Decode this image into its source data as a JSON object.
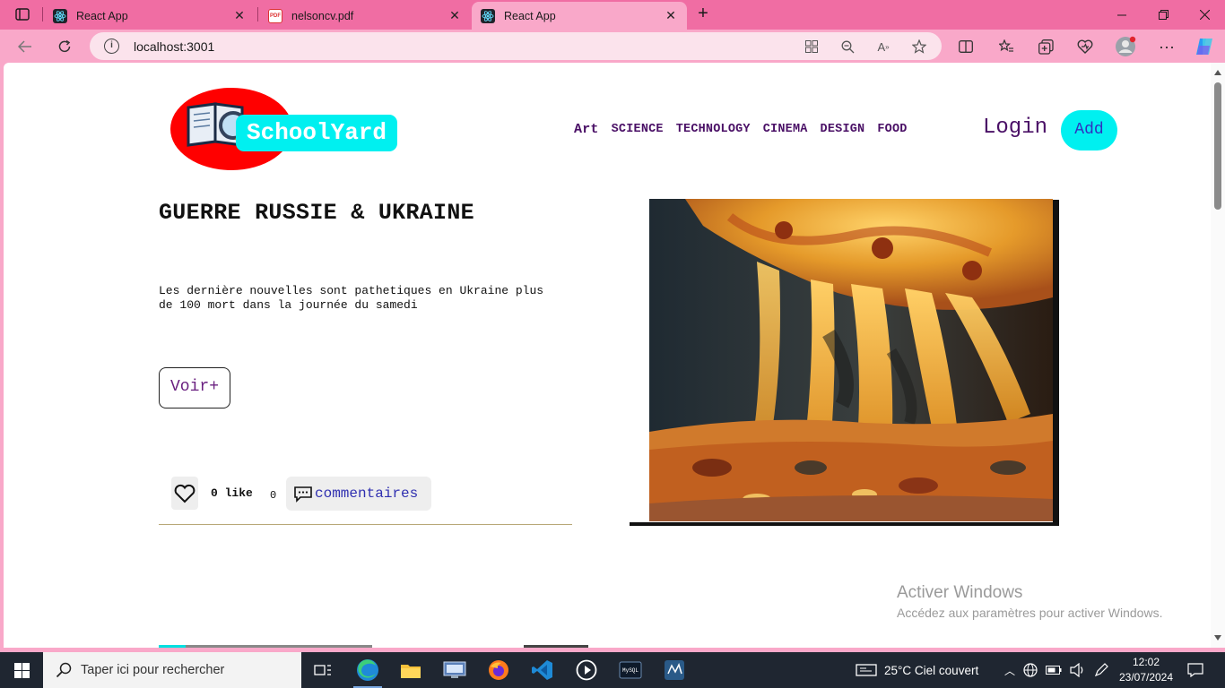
{
  "browser": {
    "tabs": [
      {
        "title": "React App",
        "type": "react"
      },
      {
        "title": "nelsoncv.pdf",
        "type": "pdf"
      },
      {
        "title": "React App",
        "type": "react"
      }
    ],
    "url": "localhost:3001"
  },
  "site": {
    "logo_text": "SchoolYard",
    "nav": [
      "Art",
      "SCIENCE",
      "TECHNOLOGY",
      "CINEMA",
      "DESIGN",
      "FOOD"
    ],
    "login_label": "Login",
    "add_label": "Add"
  },
  "post": {
    "title": "GUERRE RUSSIE & UKRAINE",
    "description": "Les dernière nouvelles sont pathetiques en Ukraine plus de 100 mort dans la journée du samedi",
    "voir_label": "Voir+",
    "like_label": "0 like",
    "comment_count": "0",
    "comment_label": "commentaires",
    "image_subject": "cheesy pizza slice"
  },
  "watermark": {
    "line1": "Activer Windows",
    "line2": "Accédez aux paramètres pour activer Windows."
  },
  "taskbar": {
    "search_placeholder": "Taper ici pour rechercher",
    "weather": "25°C  Ciel couvert",
    "time": "12:02",
    "date": "23/07/2024"
  },
  "colors": {
    "chrome_pink": "#f06da3",
    "light_pink": "#f9a8c9",
    "logo_red": "#ff0000",
    "cyan": "#00f0f0",
    "nav_purple": "#4a1066"
  }
}
